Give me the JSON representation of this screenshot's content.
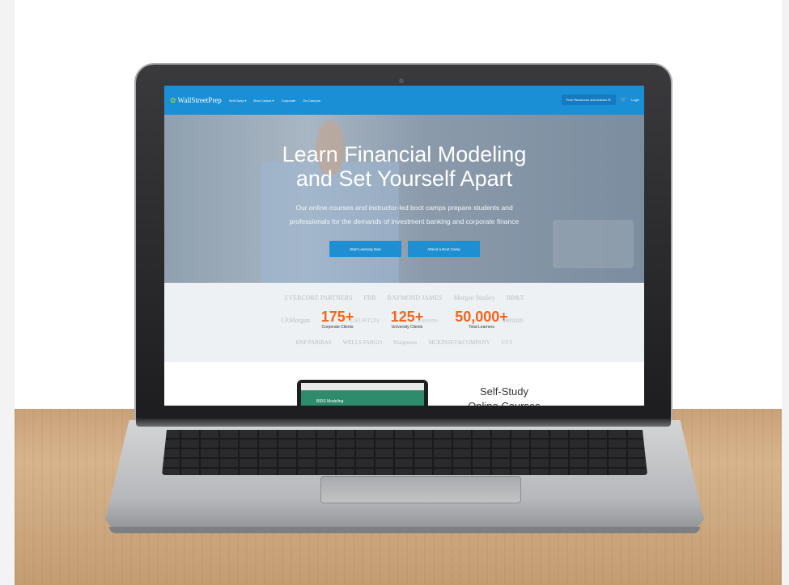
{
  "site": {
    "brand": "WallStreetPrep",
    "nav": {
      "links": [
        {
          "label": "Self-Study",
          "chevron": true
        },
        {
          "label": "Boot Camps",
          "chevron": true
        },
        {
          "label": "Corporate",
          "chevron": false
        },
        {
          "label": "On-Campus",
          "chevron": false
        }
      ],
      "resources_label": "Free Resources and Articles",
      "login_label": "Login"
    },
    "hero": {
      "title_line1": "Learn Financial Modeling",
      "title_line2": "and Set Yourself Apart",
      "subtitle_line1": "Our online courses and instructor-led boot camps prepare students and",
      "subtitle_line2": "professionals for the demands of investment banking and corporate finance",
      "btn_primary": "Start Learning Now",
      "btn_secondary": "Attend a Boot Camp"
    },
    "clients": {
      "logos_row1": [
        "EVERCORE PARTNERS",
        "FBR",
        "RAYMOND JAMES",
        "Morgan Stanley",
        "BB&T"
      ],
      "logos_row2_left": "J.P.Morgan",
      "logos_row2_mid1": "LIBURTON",
      "logos_row2_mid2": "Deloitte.",
      "logos_row2_right": "verizon",
      "logos_row3": [
        "BNP PARIBAS",
        "WELLS FARGO",
        "Walgreens",
        "MCKINSEY&COMPANY",
        "CVS"
      ],
      "stats": [
        {
          "number": "175+",
          "label": "Corporate Clients"
        },
        {
          "number": "125+",
          "label": "University Clients"
        },
        {
          "number": "50,000+",
          "label": "Total Learners"
        }
      ]
    },
    "self_study": {
      "title_line1": "Self-Study",
      "title_line2": "Online Courses",
      "preview_text": "BIDS Modeling"
    }
  },
  "colors": {
    "nav_blue": "#1a8fd6",
    "button_blue": "#1f8fd4",
    "stat_orange": "#f0661c"
  }
}
